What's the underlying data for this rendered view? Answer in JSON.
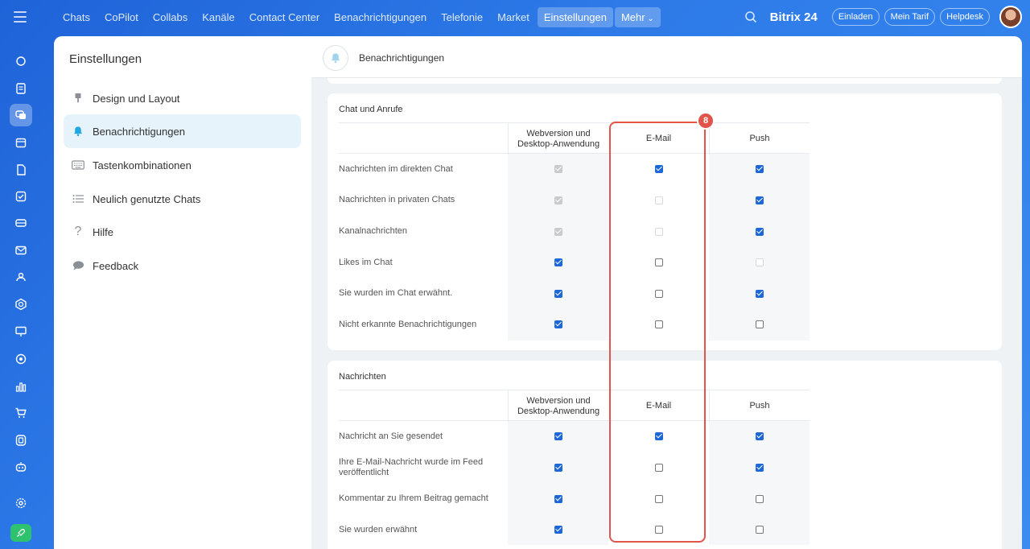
{
  "topnav": {
    "items": [
      "Chats",
      "CoPilot",
      "Collabs",
      "Kanäle",
      "Contact Center",
      "Benachrichtigungen",
      "Telefonie",
      "Market",
      "Einstellungen",
      "Mehr"
    ],
    "active": "Einstellungen",
    "brand": "Bitrix 24",
    "invite": "Einladen",
    "tariff": "Mein Tarif",
    "helpdesk": "Helpdesk"
  },
  "settings": {
    "title": "Einstellungen",
    "menu": [
      {
        "label": "Design und Layout",
        "icon": "brush-icon"
      },
      {
        "label": "Benachrichtigungen",
        "icon": "bell-icon"
      },
      {
        "label": "Tastenkombinationen",
        "icon": "keyboard-icon"
      },
      {
        "label": "Neulich genutzte Chats",
        "icon": "list-icon"
      },
      {
        "label": "Hilfe",
        "icon": "question-icon"
      },
      {
        "label": "Feedback",
        "icon": "speech-bubble-icon"
      }
    ]
  },
  "content": {
    "title": "Benachrichtigungen",
    "columns": [
      "Webversion und Desktop-Anwendung",
      "E-Mail",
      "Push"
    ],
    "sections": [
      {
        "title": "Chat und Anrufe",
        "rows": [
          {
            "label": "Nachrichten im direkten Chat",
            "states": [
              "dis-on",
              "on",
              "on"
            ]
          },
          {
            "label": "Nachrichten in privaten Chats",
            "states": [
              "dis-on",
              "dis-off",
              "on"
            ]
          },
          {
            "label": "Kanalnachrichten",
            "states": [
              "dis-on",
              "dis-off",
              "on"
            ]
          },
          {
            "label": "Likes im Chat",
            "states": [
              "on",
              "off",
              "dis-off"
            ]
          },
          {
            "label": "Sie wurden im Chat erwähnt.",
            "states": [
              "on",
              "off",
              "on"
            ]
          },
          {
            "label": "Nicht erkannte Benachrichtigungen",
            "states": [
              "on",
              "off",
              "off"
            ]
          }
        ]
      },
      {
        "title": "Nachrichten",
        "rows": [
          {
            "label": "Nachricht an Sie gesendet",
            "states": [
              "on",
              "on",
              "on"
            ]
          },
          {
            "label": "Ihre E-Mail-Nachricht wurde im Feed veröffentlicht",
            "states": [
              "on",
              "off",
              "on"
            ]
          },
          {
            "label": "Kommentar zu Ihrem Beitrag gemacht",
            "states": [
              "on",
              "off",
              "off"
            ]
          },
          {
            "label": "Sie wurden erwähnt",
            "states": [
              "on",
              "off",
              "off"
            ]
          }
        ]
      }
    ]
  },
  "annotation": {
    "badge": "8",
    "color": "#e0544a"
  },
  "colors": {
    "accent": "#1d67d8",
    "activeMenu": "#e6f3fb"
  }
}
